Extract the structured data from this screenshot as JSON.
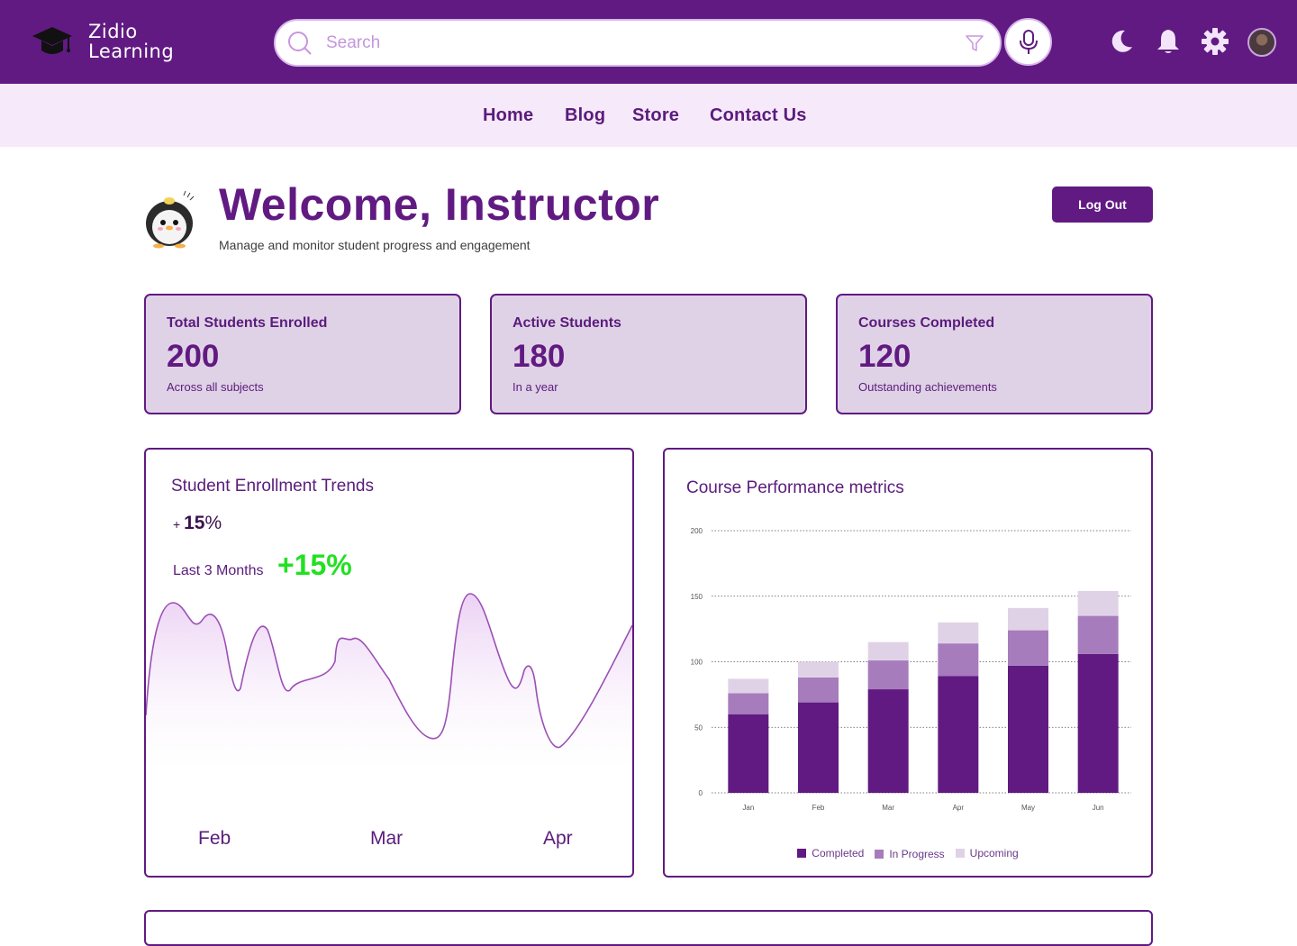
{
  "brand": {
    "line1": "Zidio",
    "line2": "Learning"
  },
  "search": {
    "placeholder": "Search"
  },
  "nav": {
    "home": "Home",
    "blog": "Blog",
    "store": "Store",
    "contact": "Contact Us"
  },
  "hero": {
    "title": "Welcome, Instructor",
    "subtitle": "Manage and monitor student progress and engagement",
    "logout_label": "Log Out"
  },
  "stats": [
    {
      "label": "Total Students Enrolled",
      "value": "200",
      "note": "Across all subjects"
    },
    {
      "label": "Active Students",
      "value": "180",
      "note": "In a year"
    },
    {
      "label": "Courses Completed",
      "value": "120",
      "note": "Outstanding achievements"
    }
  ],
  "enrollment": {
    "title": "Student Enrollment Trends",
    "growth_prefix": "+ ",
    "growth_num": "15",
    "growth_pct": "%",
    "period": "Last 3 Months",
    "growth_big": "+15%",
    "months": [
      "Feb",
      "Mar",
      "Apr"
    ],
    "color": "#9b4fb5"
  },
  "chart_data": {
    "type": "bar",
    "title": "Course Performance metrics",
    "categories": [
      "Jan",
      "Feb",
      "Mar",
      "Apr",
      "May",
      "Jun"
    ],
    "series": [
      {
        "name": "Completed",
        "values": [
          60,
          69,
          79,
          89,
          97,
          106
        ],
        "color": "#611a82"
      },
      {
        "name": "In Progress",
        "values": [
          16,
          19,
          22,
          25,
          27,
          29
        ],
        "color": "#a77cbd"
      },
      {
        "name": "Upcoming",
        "values": [
          11,
          12,
          14,
          16,
          17,
          19
        ],
        "color": "#e0d2e6"
      }
    ],
    "stacked": true,
    "ylim": [
      0,
      200
    ],
    "yticks": [
      0,
      50,
      100,
      150,
      200
    ],
    "grid": true,
    "legend": "bottom"
  },
  "colors": {
    "primary": "#611a82",
    "subnav": "#f6e9fa",
    "card": "#e0d2e6",
    "accent_green": "#22e022"
  }
}
